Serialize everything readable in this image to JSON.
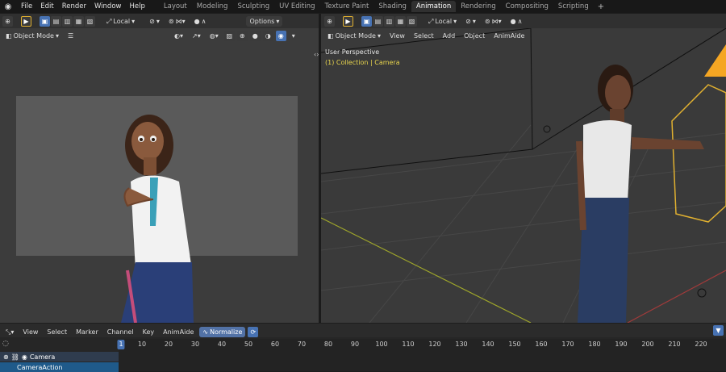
{
  "app": {
    "logo_icon": "blender-logo-icon"
  },
  "top_menu": [
    "File",
    "Edit",
    "Render",
    "Window",
    "Help"
  ],
  "workspace_tabs": [
    {
      "label": "Layout",
      "active": false
    },
    {
      "label": "Modeling",
      "active": false
    },
    {
      "label": "Sculpting",
      "active": false
    },
    {
      "label": "UV Editing",
      "active": false
    },
    {
      "label": "Texture Paint",
      "active": false
    },
    {
      "label": "Shading",
      "active": false
    },
    {
      "label": "Animation",
      "active": true
    },
    {
      "label": "Rendering",
      "active": false
    },
    {
      "label": "Compositing",
      "active": false
    },
    {
      "label": "Scripting",
      "active": false
    }
  ],
  "left_viewport": {
    "transform_orientation": "Local",
    "options_label": "Options",
    "mode_label": "Object Mode"
  },
  "right_viewport": {
    "transform_orientation": "Local",
    "mode_label": "Object Mode",
    "menus": [
      "View",
      "Select",
      "Add",
      "Object",
      "AnimAide"
    ],
    "overlay_title": "User Perspective",
    "overlay_collection": "(1) Collection | Camera"
  },
  "timeline": {
    "menus": [
      "View",
      "Select",
      "Marker",
      "Channel",
      "Key",
      "AnimAide"
    ],
    "normalize_label": "Normalize",
    "current_frame": "1",
    "ticks": [
      "10",
      "20",
      "30",
      "40",
      "50",
      "60",
      "70",
      "80",
      "90",
      "100",
      "110",
      "120",
      "130",
      "140",
      "150",
      "160",
      "170",
      "180",
      "190",
      "200",
      "210",
      "220"
    ],
    "channels": [
      {
        "label": "Camera"
      },
      {
        "label": "CameraAction"
      }
    ]
  },
  "colors": {
    "accent": "#4772b3",
    "active_tab": "#303030",
    "camera_wire": "#e0b030",
    "collection_text": "#e8d44d"
  }
}
